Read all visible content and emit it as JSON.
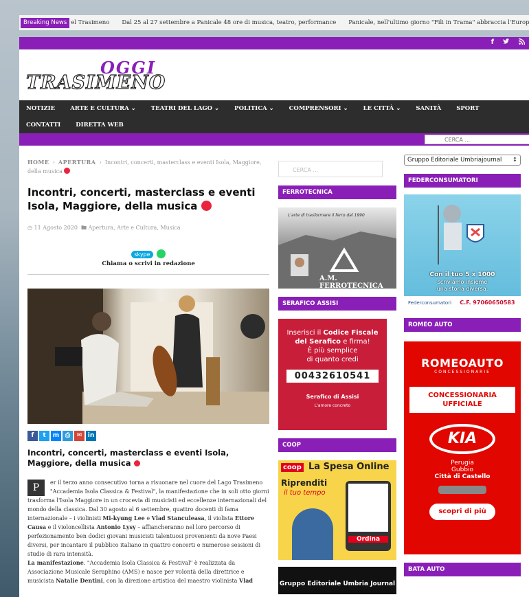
{
  "topbar": {
    "breaking_label": "Breaking News",
    "ticker": [
      "el Trasimeno",
      "Dal 25 al 27 settembre a Panicale 48 ore di musica, teatro, performance",
      "Panicale, nell'ultimo giorno \"Fili in Trama\" abbraccia l'Europa"
    ]
  },
  "social": {
    "facebook": "f",
    "twitter": "t",
    "rss": "rss"
  },
  "logo": {
    "line1": "OGGI",
    "line2": "TRASIMENO"
  },
  "nav": {
    "items": [
      "NOTIZIE",
      "ARTE E CULTURA ⌄",
      "TEATRI DEL LAGO ⌄",
      "POLITICA ⌄",
      "COMPRENSORI ⌄",
      "LE CITTÀ ⌄",
      "SANITÀ",
      "SPORT",
      "CONTATTI",
      "DIRETTA WEB"
    ],
    "search_placeholder": "CERCA ..."
  },
  "article": {
    "breadcrumb": {
      "home": "HOME",
      "sep": "›",
      "section": "APERTURA",
      "current": "Incontri, concerti, masterclass e eventi Isola, Maggiore, della musica"
    },
    "title": "Incontri, concerti, masterclass e eventi Isola, Maggiore, della musica",
    "date": "11 Agosto 2020",
    "categories": "Apertura, Arte e Cultura, Musica",
    "skype_label": "skype",
    "call_text": "Chiama o scrivi in redazione",
    "title2": "Incontri, concerti, masterclass e eventi Isola, Maggiore, della musica",
    "dropcap": "P",
    "p1_a": "er il terzo anno consecutivo torna a risuonare nel cuore del Lago Trasimeno \"Accademia Isola Classica & Festival\", la manifestazione che in soli otto giorni trasforma l'Isola Maggiore in un crocevia di musicisti ed eccellenze internazionali del mondo della classica. Dal 30 agosto al 6 settembre, quattro docenti di fama internazionale – i violinisti ",
    "p1_n1": "Mi-kyung Lee",
    "p1_b": " e ",
    "p1_n2": "Vlad Stanculeasa",
    "p1_c": ", il violista ",
    "p1_n3": "Ettore Causa",
    "p1_d": " e il violoncellista ",
    "p1_n4": "Antonio Lysy",
    "p1_e": " – affiancheranno nel loro percorso di perfezionamento ben dodici giovani musicisti talentuosi provenienti da nove Paesi diversi, per incantare il pubblico italiano in quattro concerti e numerose sessioni di studio di rara intensità.",
    "p2_label": "La manifestazione",
    "p2_a": ". \"Accademia Isola Classica & Festival\" è realizzata da Associazione Musicale Seraphino (AMS) e nasce per volontà della direttrice e musicista ",
    "p2_n1": "Natalie Dentini",
    "p2_b": ", con la direzione artistica del maestro violinista ",
    "p2_n2": "Vlad"
  },
  "mid_sidebar": {
    "search_placeholder": "CERCA ...",
    "widgets": [
      "FERROTECNICA",
      "SERAFICO ASSISI",
      "COOP"
    ],
    "ferro": {
      "slogan": "L'arte di trasformare il ferro dal 1990",
      "brand": "A.M. FERROTECNICA"
    },
    "serafico": {
      "line1": "Inserisci il ",
      "line1_b": "Codice Fiscale",
      "line2_b": "del Serafico",
      "line2": " e firma!",
      "line3": "È più semplice",
      "line4": "di quanto credi",
      "cf": "00432610541",
      "brand": "Serafico di Assisi",
      "tagline": "L'amore concreto"
    },
    "coop": {
      "brand": "coop",
      "headline": "La Spesa Online",
      "sub1": "Riprenditi",
      "sub2": "il tuo tempo",
      "cta": "Ordina"
    },
    "gue": "Gruppo Editoriale Umbria Journal"
  },
  "right_sidebar": {
    "select_value": "Gruppo Editoriale Umbriajournal",
    "widgets": [
      "FEDERCONSUMATORI",
      "ROMEO AUTO",
      "BATA AUTO"
    ],
    "fed": {
      "line1": "Con il tuo 5 x 1000",
      "line2": "scriviamo insieme",
      "line3": "una storia diversa.",
      "brand": "Federconsumatori",
      "cf": "C.F. 97060650583"
    },
    "romeo": {
      "brand": "ROMEOAUTO",
      "sub": "CONCESSIONARIE",
      "line1": "CONCESSIONARIA",
      "line2": "UFFICIALE",
      "kia": "KIA",
      "city1": "Perugia",
      "city2": "Gubbio",
      "city3": "Città di Castello",
      "cta": "scopri di più"
    }
  },
  "colors": {
    "accent": "#8a1fb8",
    "nav_bg": "#2d2d2d",
    "red": "#e8243f"
  }
}
